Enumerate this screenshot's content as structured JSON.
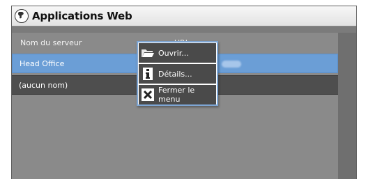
{
  "window": {
    "title": "Applications Web",
    "icon": "globe-icon"
  },
  "list": {
    "columns": [
      "Nom du serveur",
      "URL"
    ],
    "rows": [
      {
        "name": "Head Office",
        "selected": true
      },
      {
        "name": "(aucun nom)",
        "selected": false
      }
    ]
  },
  "context_menu": {
    "items": [
      {
        "label": "Ouvrir...",
        "icon": "folder-open-icon"
      },
      {
        "label": "Détails...",
        "icon": "info-icon"
      },
      {
        "label": "Fermer le menu",
        "icon": "close-icon"
      }
    ]
  },
  "colors": {
    "selection": "#6b9ed6",
    "menu_border": "#7ea6d4",
    "panel": "#8a8a8a"
  }
}
